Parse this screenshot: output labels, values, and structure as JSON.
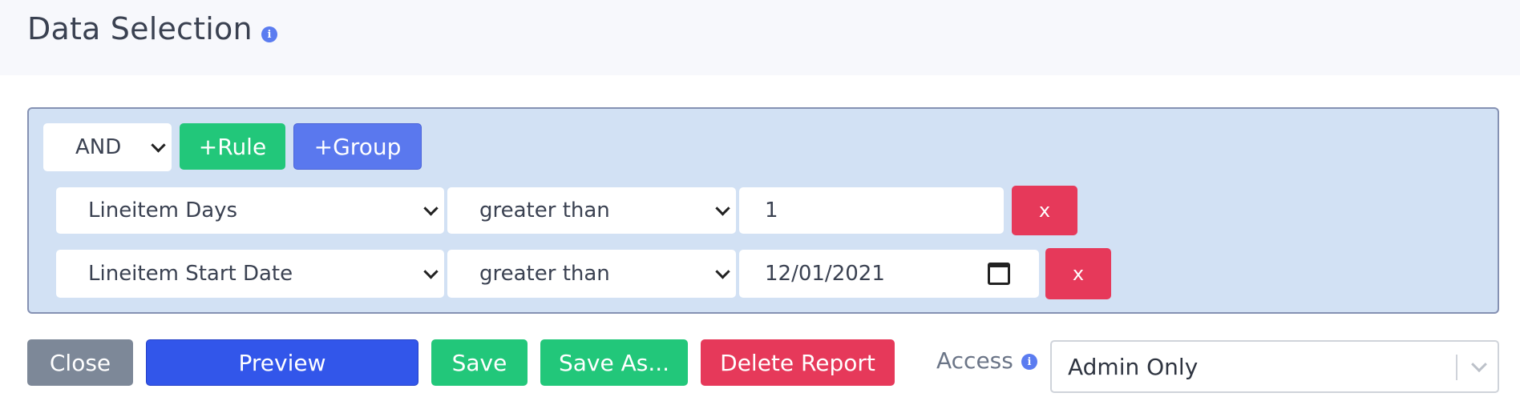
{
  "header": {
    "title": "Data Selection",
    "info_icon": "info-icon"
  },
  "query_builder": {
    "condition": "AND",
    "add_rule_label": "+Rule",
    "add_group_label": "+Group",
    "rules": [
      {
        "field": "Lineitem Days",
        "operator": "greater than",
        "value": "1",
        "remove_label": "x"
      },
      {
        "field": "Lineitem Start Date",
        "operator": "greater than",
        "value": "12/01/2021",
        "value_icon": "calendar-icon",
        "remove_label": "x"
      }
    ]
  },
  "actions": {
    "close_label": "Close",
    "preview_label": "Preview",
    "save_label": "Save",
    "save_as_label": "Save As...",
    "delete_label": "Delete Report"
  },
  "access": {
    "label": "Access",
    "value": "Admin Only",
    "info_icon": "info-icon"
  },
  "colors": {
    "green": "#22c77a",
    "blue": "#5a78ee",
    "red": "#e6395a",
    "gray": "#7d8898",
    "primary": "#3256ea",
    "panel": "#d2e1f4"
  }
}
